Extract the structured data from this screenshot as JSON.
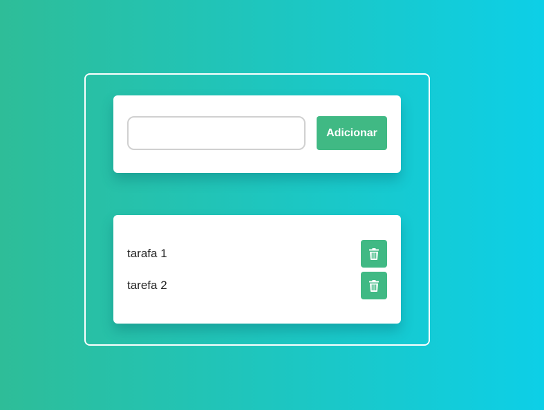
{
  "form": {
    "input_value": "",
    "add_label": "Adicionar"
  },
  "tasks": [
    {
      "label": "tarafa 1"
    },
    {
      "label": "tarefa 2"
    }
  ],
  "icons": {
    "delete": "trash-icon"
  },
  "colors": {
    "accent": "#40b984",
    "gradient_start": "#2ebd98",
    "gradient_end": "#0dcfe7",
    "card": "#ffffff"
  }
}
